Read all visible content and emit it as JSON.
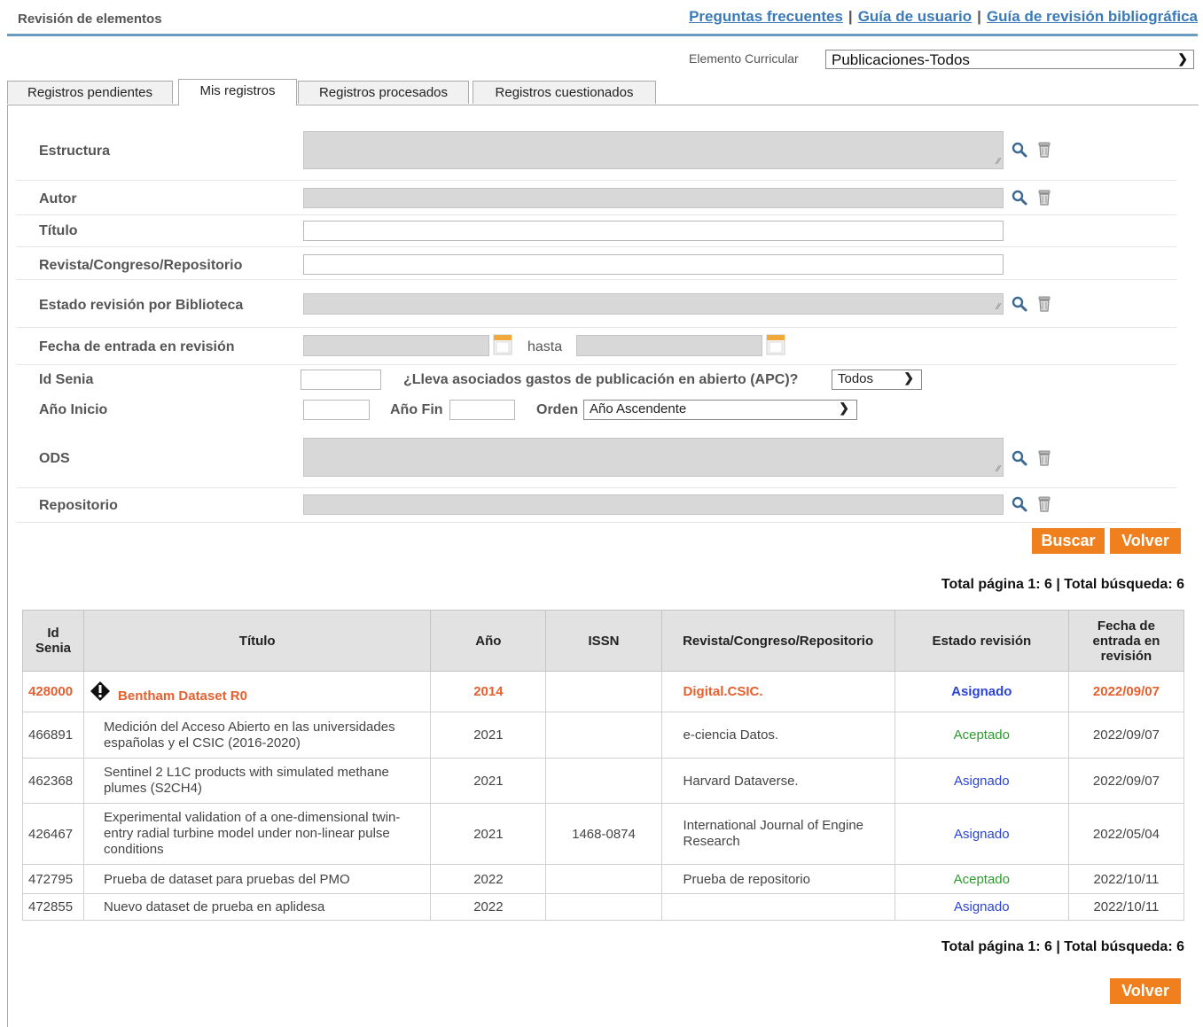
{
  "header": {
    "title": "Revisión de elementos",
    "links": [
      "Preguntas frecuentes",
      "Guía de usuario",
      "Guía de revisión bibliográfica"
    ],
    "separator": "|"
  },
  "elemento_curricular": {
    "label": "Elemento Curricular",
    "value": "Publicaciones-Todos"
  },
  "tabs": [
    {
      "label": "Registros pendientes",
      "active": false
    },
    {
      "label": "Mis registros",
      "active": true
    },
    {
      "label": "Registros procesados",
      "active": false
    },
    {
      "label": "Registros cuestionados",
      "active": false
    }
  ],
  "form": {
    "estructura": "Estructura",
    "autor": "Autor",
    "titulo": "Título",
    "revista": "Revista/Congreso/Repositorio",
    "estado": "Estado revisión por Biblioteca",
    "fecha": "Fecha de entrada en revisión",
    "hasta": "hasta",
    "id_senia": "Id Senia",
    "apc_label": "¿Lleva asociados gastos de publicación en abierto (APC)?",
    "apc_value": "Todos",
    "anio_inicio": "Año Inicio",
    "anio_fin": "Año Fin",
    "orden_label": "Orden",
    "orden_value": "Año Ascendente",
    "ods": "ODS",
    "repositorio": "Repositorio"
  },
  "buttons": {
    "buscar": "Buscar",
    "volver": "Volver"
  },
  "totals": "Total página 1: 6 | Total búsqueda: 6",
  "table": {
    "headers": [
      "Id Senia",
      "Título",
      "Año",
      "ISSN",
      "Revista/Congreso/Repositorio",
      "Estado revisión",
      "Fecha de entrada en revisión"
    ],
    "rows": [
      {
        "id": "428000",
        "titulo": "Bentham Dataset R0",
        "anio": "2014",
        "issn": "",
        "revista": "Digital.CSIC.",
        "estado": "Asignado",
        "fecha": "2022/09/07",
        "highlight": true
      },
      {
        "id": "466891",
        "titulo": "Medición del Acceso Abierto en las universidades españolas y el CSIC (2016-2020)",
        "anio": "2021",
        "issn": "",
        "revista": "e-ciencia Datos.",
        "estado": "Aceptado",
        "fecha": "2022/09/07"
      },
      {
        "id": "462368",
        "titulo": "Sentinel 2 L1C products with simulated methane plumes (S2CH4)",
        "anio": "2021",
        "issn": "",
        "revista": "Harvard Dataverse.",
        "estado": "Asignado",
        "fecha": "2022/09/07"
      },
      {
        "id": "426467",
        "titulo": "Experimental validation of a one-dimensional twin-entry radial turbine model under non-linear pulse conditions",
        "anio": "2021",
        "issn": "1468-0874",
        "revista": "International Journal of Engine Research",
        "estado": "Asignado",
        "fecha": "2022/05/04"
      },
      {
        "id": "472795",
        "titulo": "Prueba de dataset para pruebas del PMO",
        "anio": "2022",
        "issn": "",
        "revista": "Prueba de repositorio",
        "estado": "Aceptado",
        "fecha": "2022/10/11"
      },
      {
        "id": "472855",
        "titulo": "Nuevo dataset de prueba en aplidesa",
        "anio": "2022",
        "issn": "",
        "revista": "",
        "estado": "Asignado",
        "fecha": "2022/10/11"
      }
    ]
  },
  "colors": {
    "accent": "#f07f1d",
    "link": "#3a7ab8",
    "asignado": "#2b44d8",
    "aceptado": "#2b9b2b",
    "highlight": "#e5602e"
  },
  "icons": [
    "search-icon",
    "trash-icon",
    "calendar-icon",
    "warning-icon",
    "chevron-down-icon"
  ]
}
